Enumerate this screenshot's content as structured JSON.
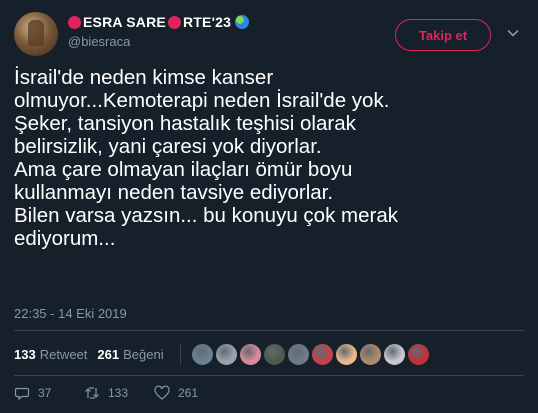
{
  "user": {
    "name_part1": "ESRA SARE",
    "name_part2": "RTE'23",
    "handle": "@biesraca"
  },
  "follow_label": "Takip et",
  "tweet": {
    "text": "İsrail'de neden kimse kanser\nolmuyor...Kemoterapi neden İsrail'de yok.\nŞeker, tansiyon hastalık teşhisi olarak\nbelirsizlik, yani çaresi yok diyorlar.\nAma çare olmayan ilaçları ömür boyu\nkullanmayı neden tavsiye ediyorlar.\nBilen varsa  yazsın... bu konuyu çok merak\nediyorum...",
    "timestamp": "22:35 - 14 Eki 2019"
  },
  "stats": {
    "retweets": "133",
    "retweets_label": "Retweet",
    "likes": "261",
    "likes_label": "Beğeni"
  },
  "liker_colors": [
    "#6b7f95",
    "#9aa3ad",
    "#d98a9a",
    "#4b5a4a",
    "#6e7b8a",
    "#c0424a",
    "#e7b98a",
    "#b08a6a",
    "#c8c8d0",
    "#c0303a"
  ],
  "actions": {
    "replies": "37",
    "retweets": "133",
    "likes": "261"
  },
  "colors": {
    "background": "#15202b",
    "accent": "#e0245e",
    "muted": "#8899a6",
    "divider": "#38444d"
  },
  "icons": [
    "chevron-down-icon",
    "reply-icon",
    "retweet-icon",
    "heart-icon",
    "globe-emoji-icon",
    "red-circle-emoji-icon"
  ]
}
